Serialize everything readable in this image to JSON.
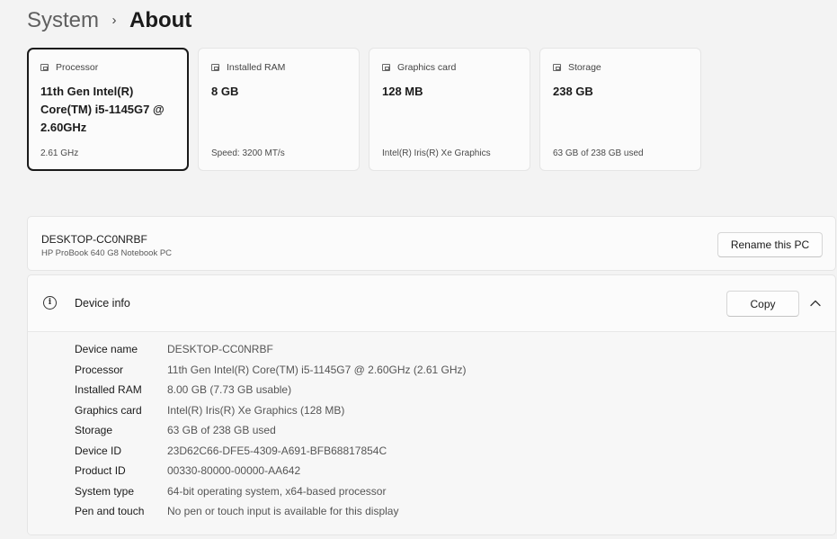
{
  "breadcrumb": {
    "parent": "System",
    "separator": "›",
    "current": "About"
  },
  "cards": [
    {
      "icon": "processor-icon",
      "label": "Processor",
      "value": "11th Gen Intel(R) Core(TM) i5-1145G7 @ 2.60GHz",
      "sub": "2.61 GHz",
      "selected": true
    },
    {
      "icon": "ram-icon",
      "label": "Installed RAM",
      "value": "8 GB",
      "sub": "Speed: 3200 MT/s"
    },
    {
      "icon": "graphics-card-icon",
      "label": "Graphics card",
      "value": "128 MB",
      "sub": "Intel(R) Iris(R) Xe Graphics"
    },
    {
      "icon": "storage-icon",
      "label": "Storage",
      "value": "238 GB",
      "sub": "63 GB of 238 GB used"
    }
  ],
  "pc": {
    "name": "DESKTOP-CC0NRBF",
    "model": "HP ProBook 640 G8 Notebook PC",
    "rename_label": "Rename this PC"
  },
  "device_info": {
    "icon": "info-icon",
    "title": "Device info",
    "copy_label": "Copy",
    "expanded": true,
    "specs": [
      {
        "key": "Device name",
        "value": "DESKTOP-CC0NRBF"
      },
      {
        "key": "Processor",
        "value": "11th Gen Intel(R) Core(TM) i5-1145G7 @ 2.60GHz (2.61 GHz)"
      },
      {
        "key": "Installed RAM",
        "value": "8.00 GB (7.73 GB usable)"
      },
      {
        "key": "Graphics card",
        "value": "Intel(R) Iris(R) Xe Graphics (128 MB)"
      },
      {
        "key": "Storage",
        "value": "63 GB of 238 GB used"
      },
      {
        "key": "Device ID",
        "value": "23D62C66-DFE5-4309-A691-BFB68817854C"
      },
      {
        "key": "Product ID",
        "value": "00330-80000-00000-AA642"
      },
      {
        "key": "System type",
        "value": "64-bit operating system, x64-based processor"
      },
      {
        "key": "Pen and touch",
        "value": "No pen or touch input is available for this display"
      }
    ]
  }
}
